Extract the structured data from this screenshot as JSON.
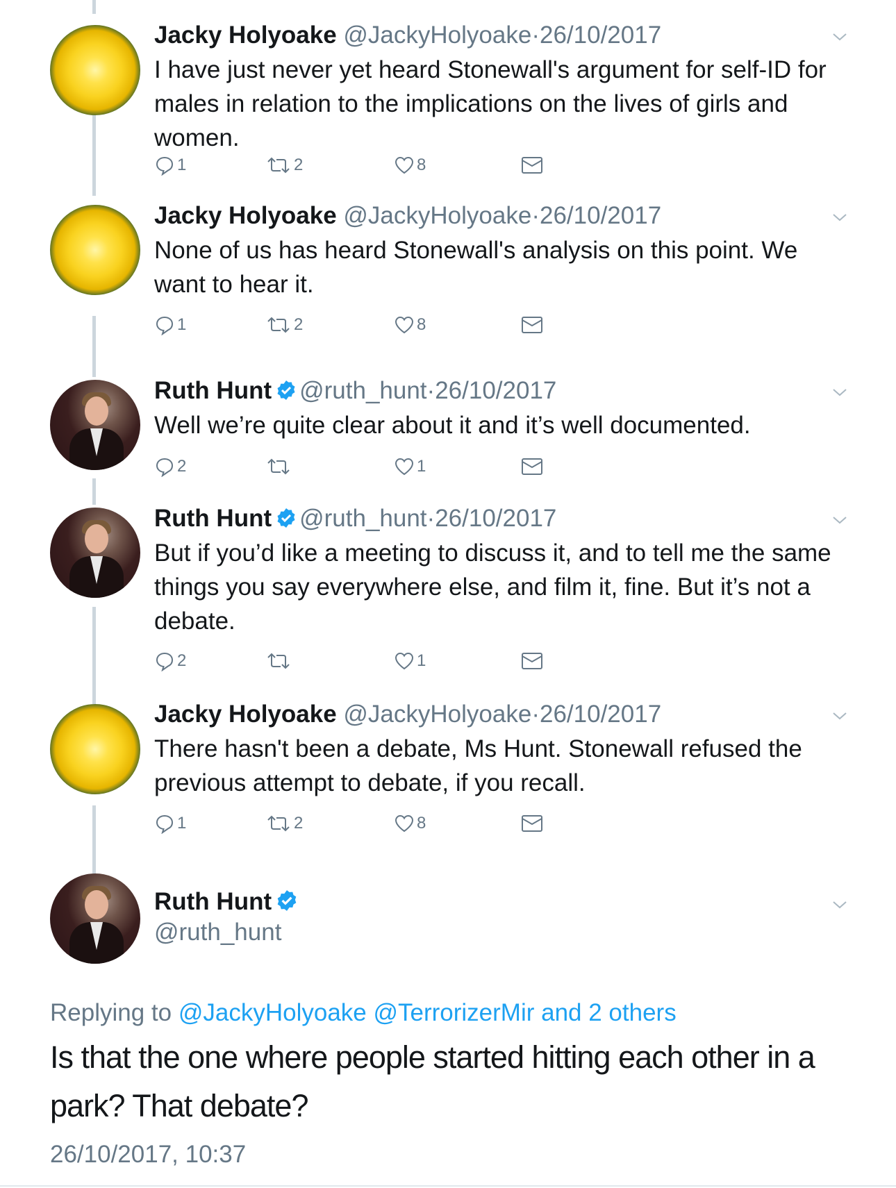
{
  "colors": {
    "accent": "#1da1f2",
    "secondary_text": "#657786",
    "thread_line": "#ccd6dd"
  },
  "tweets": [
    {
      "name": "Jacky Holyoake",
      "handle": "@JackyHolyoake",
      "date": "26/10/2017",
      "text": "I have just never yet heard Stonewall's argument for self-ID for males in relation to the implications on the lives of girls and women.",
      "replies": "1",
      "retweets": "2",
      "likes": "8"
    },
    {
      "name": "Jacky Holyoake",
      "handle": "@JackyHolyoake",
      "date": "26/10/2017",
      "text": "None of us has heard Stonewall's analysis on this point. We want to hear it.",
      "replies": "1",
      "retweets": "2",
      "likes": "8"
    },
    {
      "name": "Ruth Hunt",
      "handle": "@ruth_hunt",
      "date": "26/10/2017",
      "text": "Well we’re quite clear about it and it’s well documented.",
      "replies": "2",
      "retweets": "",
      "likes": "1"
    },
    {
      "name": "Ruth Hunt",
      "handle": "@ruth_hunt",
      "date": "26/10/2017",
      "text": "But if you’d like a meeting to discuss it, and to tell me the same things you say everywhere else, and film it, fine. But it’s not a debate.",
      "replies": "2",
      "retweets": "",
      "likes": "1"
    },
    {
      "name": "Jacky Holyoake",
      "handle": "@JackyHolyoake",
      "date": "26/10/2017",
      "text": "There hasn't been a debate, Ms Hunt. Stonewall refused the previous attempt to debate, if you recall.",
      "replies": "1",
      "retweets": "2",
      "likes": "8"
    }
  ],
  "main_tweet": {
    "name": "Ruth Hunt",
    "handle": "@ruth_hunt",
    "replying_prefix": "Replying to",
    "replying_to": "@JackyHolyoake @TerrorizerMir and 2 others",
    "text": "Is that the one where people started hitting each other in a park? That debate?",
    "timestamp": "26/10/2017, 10:37"
  }
}
